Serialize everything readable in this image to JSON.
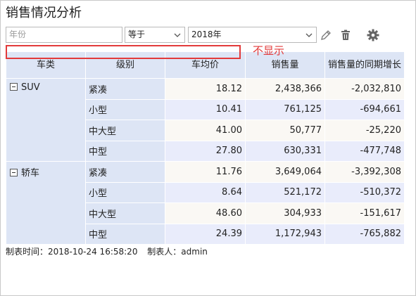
{
  "report": {
    "title": "销售情况分析"
  },
  "filter": {
    "field_placeholder": "年份",
    "operator": "等于",
    "value": "2018年"
  },
  "annotation": {
    "label": "不显示"
  },
  "table": {
    "headers": [
      "车类",
      "级别",
      "车均价",
      "销售量",
      "销售量的同期增长"
    ],
    "groups": [
      {
        "name": "SUV",
        "rows": [
          {
            "level": "紧凑",
            "avg_price": "18.12",
            "sales": "2,438,366",
            "yoy": "-2,032,810"
          },
          {
            "level": "小型",
            "avg_price": "10.41",
            "sales": "761,125",
            "yoy": "-694,661"
          },
          {
            "level": "中大型",
            "avg_price": "41.00",
            "sales": "50,777",
            "yoy": "-25,220"
          },
          {
            "level": "中型",
            "avg_price": "27.80",
            "sales": "630,331",
            "yoy": "-477,748"
          }
        ]
      },
      {
        "name": "轿车",
        "rows": [
          {
            "level": "紧凑",
            "avg_price": "11.76",
            "sales": "3,649,064",
            "yoy": "-3,392,308"
          },
          {
            "level": "小型",
            "avg_price": "8.64",
            "sales": "521,172",
            "yoy": "-510,372"
          },
          {
            "level": "中大型",
            "avg_price": "48.60",
            "sales": "304,933",
            "yoy": "-151,617"
          },
          {
            "level": "中型",
            "avg_price": "24.39",
            "sales": "1,172,943",
            "yoy": "-765,882"
          }
        ]
      }
    ]
  },
  "footer": {
    "created_time": "制表时间：2018-10-24 16:58:20",
    "created_by": "制表人：admin"
  },
  "icons": {
    "edit": "pencil-icon",
    "delete": "trash-icon",
    "settings": "gear-icon"
  },
  "colors": {
    "header_bg": "#dde5f5",
    "row_even": "#f6f6fc",
    "row_odd": "#e9ecfb",
    "annotation": "#e23a3a"
  }
}
